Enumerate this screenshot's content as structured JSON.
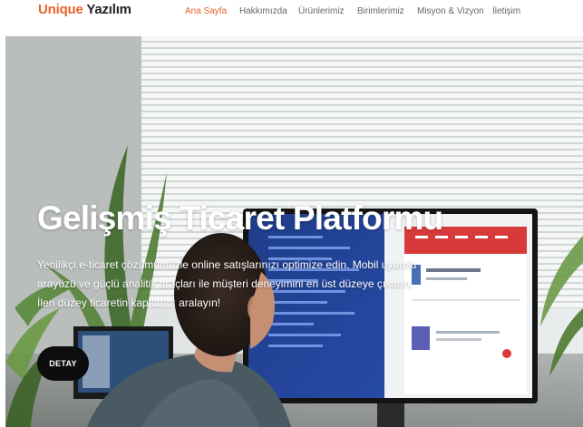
{
  "header": {
    "logo": {
      "brand": "Unique",
      "rest": " Yazılım"
    },
    "nav": [
      {
        "label": "Ana Sayfa",
        "active": true
      },
      {
        "label": "Hakkımızda",
        "active": false
      },
      {
        "label": "Ürünlerimiz",
        "active": false
      },
      {
        "label": "Birimlerimiz",
        "active": false
      },
      {
        "label": "Misyon & Vizyon",
        "active": false
      },
      {
        "label": "İletişim",
        "active": false
      }
    ]
  },
  "hero": {
    "title": "Gelişmiş Ticaret Platformu",
    "description": "Yenilikçi e-ticaret çözümümüzle online satışlarınızı optimize edin. Mobil uyumlu arayüzü ve güçlü analitik araçları ile müşteri deneyimini en üst düzeye çıkarın. İleri düzey ticaretin kapılarını aralayın!",
    "button_label": "DETAY"
  },
  "colors": {
    "accent": "#e8622d",
    "button_bg": "#0d0d0d",
    "nav_text": "#666666"
  }
}
